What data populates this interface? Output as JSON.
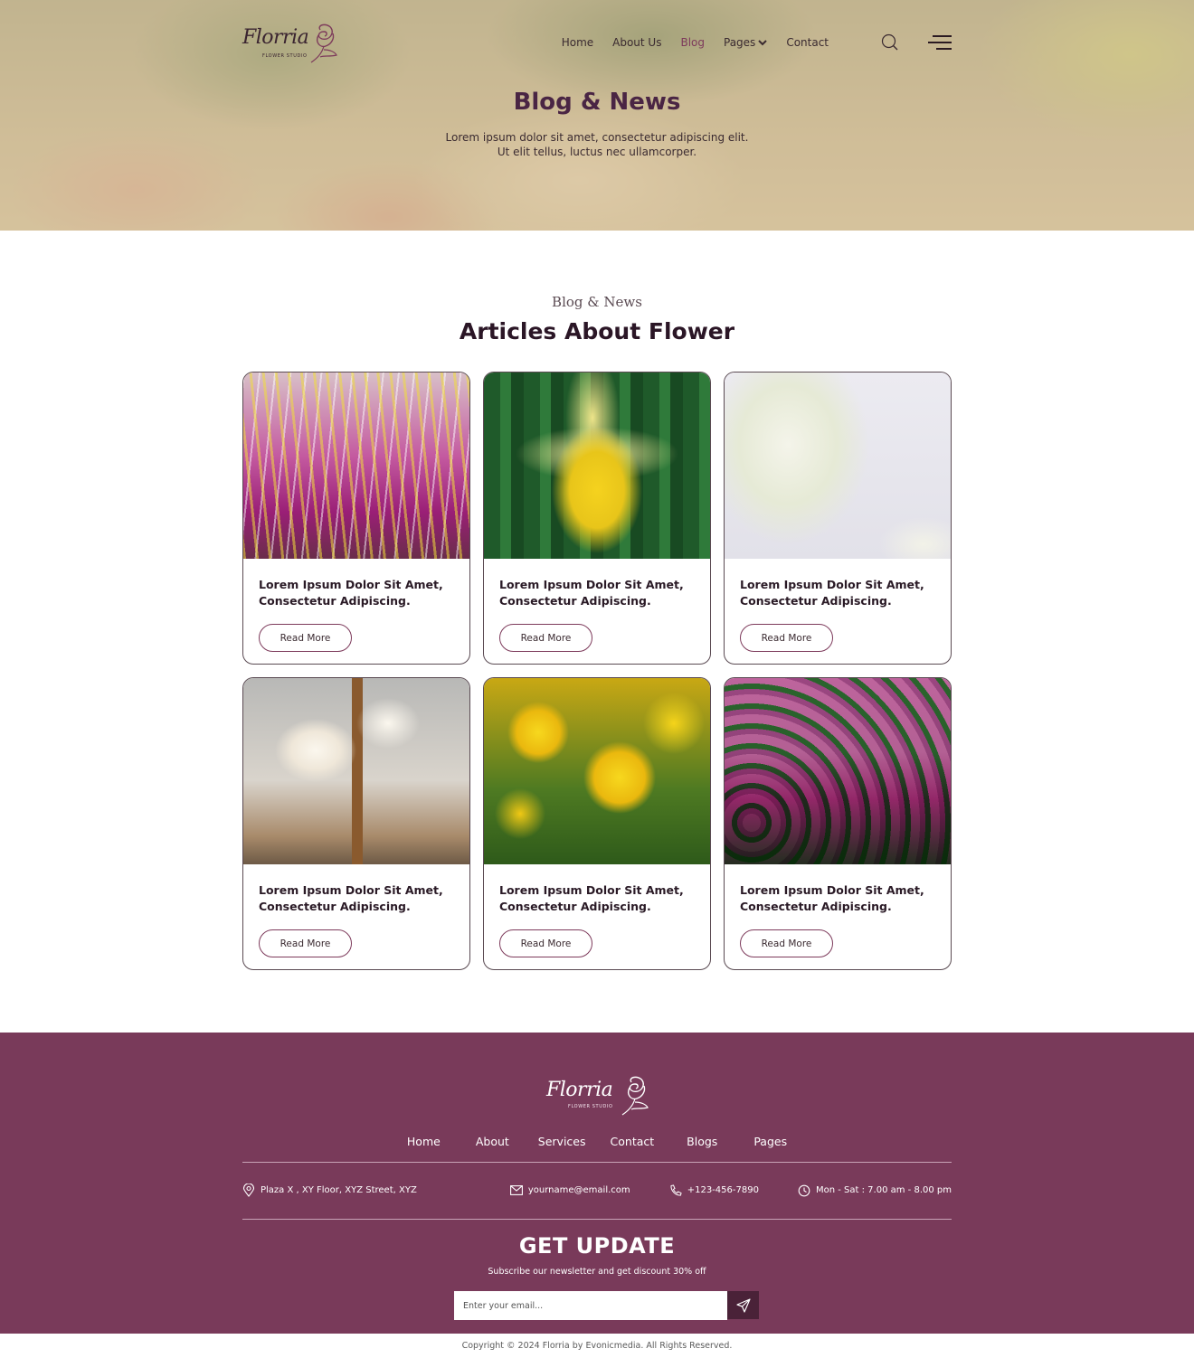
{
  "brand": {
    "name": "Florria",
    "tagline": "FLOWER STUDIO"
  },
  "nav": {
    "items": [
      {
        "label": "Home",
        "active": false
      },
      {
        "label": "About Us",
        "active": false
      },
      {
        "label": "Blog",
        "active": true
      },
      {
        "label": "Pages",
        "active": false,
        "has_dropdown": true
      },
      {
        "label": "Contact",
        "active": false
      }
    ],
    "icons": [
      "search-icon",
      "hamburger-menu-icon"
    ]
  },
  "hero": {
    "title": "Blog & News",
    "subtitle_line1": "Lorem ipsum dolor sit amet, consectetur adipiscing elit.",
    "subtitle_line2": "Ut elit tellus, luctus nec ullamcorper."
  },
  "articles": {
    "kicker": "Blog & News",
    "title": "Articles About Flower",
    "read_more_label": "Read More",
    "cards": [
      {
        "title_line1": "Lorem Ipsum Dolor Sit Amet,",
        "title_line2": "Consectetur Adipiscing.",
        "image": "heather flowers"
      },
      {
        "title_line1": "Lorem Ipsum Dolor Sit Amet,",
        "title_line2": "Consectetur Adipiscing.",
        "image": "yellow daffodil"
      },
      {
        "title_line1": "Lorem Ipsum Dolor Sit Amet,",
        "title_line2": "Consectetur Adipiscing.",
        "image": "white flowers in vase"
      },
      {
        "title_line1": "Lorem Ipsum Dolor Sit Amet,",
        "title_line2": "Consectetur Adipiscing.",
        "image": "white roses in glass vases"
      },
      {
        "title_line1": "Lorem Ipsum Dolor Sit Amet,",
        "title_line2": "Consectetur Adipiscing.",
        "image": "yellow double tulips"
      },
      {
        "title_line1": "Lorem Ipsum Dolor Sit Amet,",
        "title_line2": "Consectetur Adipiscing.",
        "image": "pink and white tulips"
      }
    ]
  },
  "footer": {
    "nav": [
      "Home",
      "About",
      "Services",
      "Contact",
      "Blogs",
      "Pages"
    ],
    "contact": {
      "address": "Plaza X , XY Floor, XYZ Street, XYZ",
      "email": "yourname@email.com",
      "phone": "+123-456-7890",
      "hours": "Mon - Sat : 7.00 am - 8.00 pm"
    },
    "newsletter": {
      "title": "GET UPDATE",
      "text": "Subscribe our newsletter and get discount 30% off",
      "placeholder": "Enter your email...",
      "value": ""
    },
    "copyright": "Copyright © 2024 Florria by Evonicmedia. All Rights Reserved."
  },
  "colors": {
    "brand": "#793a5a",
    "brand_dark": "#4a2238",
    "heading": "#4a2544",
    "active_nav": "#7d3a5b"
  }
}
